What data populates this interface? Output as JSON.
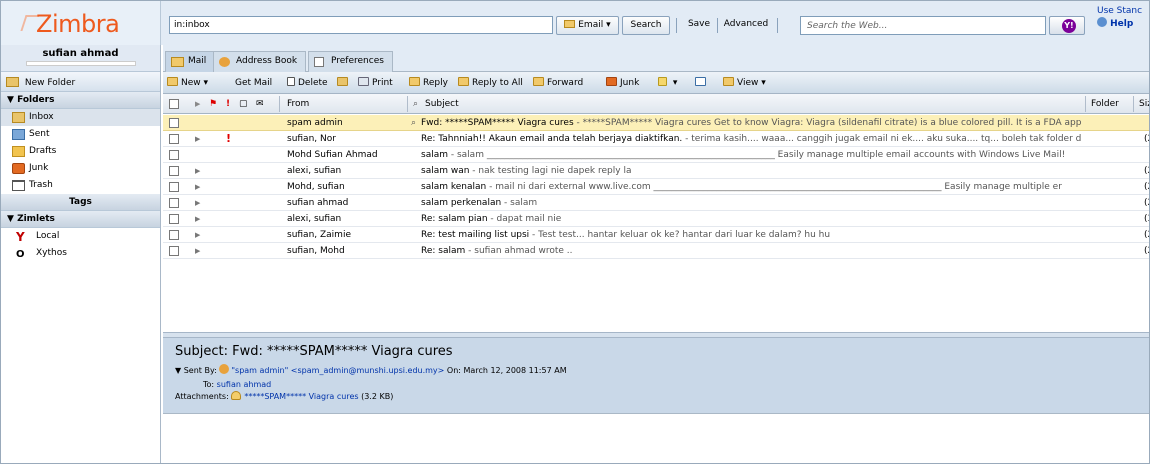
{
  "app": {
    "logo": "Zimbra"
  },
  "header": {
    "search_value": "in:inbox",
    "email_button": "Email",
    "search_button": "Search",
    "save_button": "Save",
    "advanced_button": "Advanced",
    "web_search_placeholder": "Search the Web...",
    "top_right_link1": "Use Stanc",
    "top_right_link2": "Help"
  },
  "user": {
    "name": "sufian ahmad"
  },
  "sidebar": {
    "new_folder": "New Folder",
    "folders_title": "Folders",
    "folders": [
      {
        "label": "Inbox",
        "icon": "inbox-icon"
      },
      {
        "label": "Sent",
        "icon": "sent-icon"
      },
      {
        "label": "Drafts",
        "icon": "drafts-icon"
      },
      {
        "label": "Junk",
        "icon": "junk-icon"
      },
      {
        "label": "Trash",
        "icon": "trash-icon"
      }
    ],
    "tags_title": "Tags",
    "zimlets_title": "Zimlets",
    "zimlets": [
      {
        "label": "Local",
        "icon": "yahoo-local-icon"
      },
      {
        "label": "Xythos",
        "icon": "xythos-icon"
      }
    ]
  },
  "tabs": [
    "Mail",
    "Address Book",
    "Preferences"
  ],
  "toolbar": {
    "new": "New",
    "get_mail": "Get Mail",
    "delete": "Delete",
    "print": "Print",
    "reply": "Reply",
    "reply_all": "Reply to All",
    "forward": "Forward",
    "junk": "Junk",
    "view": "View"
  },
  "list_columns": {
    "from": "From",
    "subject": "Subject",
    "folder": "Folder",
    "size": "Size"
  },
  "messages": [
    {
      "from": "spam admin",
      "subject": "Fwd: *****SPAM***** Viagra cures",
      "fragment": " - *****SPAM***** Viagra cures Get to know Viagra: Viagra (sildenafil citrate) is a blue colored pill. It is a FDA approved",
      "size": "",
      "flag": false,
      "expand": false,
      "attach": true,
      "selected": true
    },
    {
      "from": "sufian, Nor",
      "subject": "Re: Tahnniah!! Akaun email anda telah berjaya diaktifkan.",
      "fragment": " - terima kasih.... waaa... canggih jugak email ni ek.... aku suka.... tq... boleh tak folder dan addre",
      "size": "(2",
      "flag": true,
      "expand": true,
      "attach": false,
      "selected": false
    },
    {
      "from": "Mohd Sufian Ahmad",
      "subject": "salam",
      "fragment": " - salam ________________________________________________________________ Easily manage multiple email accounts with Windows Live Mail!",
      "size": "",
      "flag": false,
      "expand": false,
      "attach": false,
      "selected": false
    },
    {
      "from": "alexi, sufian",
      "subject": "salam wan",
      "fragment": " - nak testing lagi nie dapek reply la",
      "size": "(2",
      "flag": false,
      "expand": true,
      "attach": false,
      "selected": false
    },
    {
      "from": "Mohd, sufian",
      "subject": "salam kenalan",
      "fragment": " - mail ni dari external www.live.com ________________________________________________________________ Easily manage multiple er",
      "size": "(2",
      "flag": false,
      "expand": true,
      "attach": false,
      "selected": false
    },
    {
      "from": "sufian ahmad",
      "subject": "salam perkenalan",
      "fragment": " - salam",
      "size": "(2",
      "flag": false,
      "expand": true,
      "attach": false,
      "selected": false
    },
    {
      "from": "alexi, sufian",
      "subject": "Re: salam pian",
      "fragment": " - dapat mail nie",
      "size": "(3",
      "flag": false,
      "expand": true,
      "attach": false,
      "selected": false
    },
    {
      "from": "sufian, Zaimie",
      "subject": "Re: test mailing list upsi",
      "fragment": " - Test test... hantar keluar ok ke? hantar dari luar ke dalam? hu hu",
      "size": "(2",
      "flag": false,
      "expand": true,
      "attach": false,
      "selected": false
    },
    {
      "from": "sufian, Mohd",
      "subject": "Re: salam",
      "fragment": " - sufian ahmad wrote ..",
      "size": "(2",
      "flag": false,
      "expand": true,
      "attach": false,
      "selected": false
    }
  ],
  "reading": {
    "subject": "Subject: Fwd: *****SPAM***** Viagra cures",
    "sent_by_label": "Sent By:",
    "sender": "\"spam admin\" <spam_admin@munshi.upsi.edu.my>",
    "on_label": "On:",
    "date": "March 12, 2008 11:57 AM",
    "to_label": "To:",
    "to": "sufian ahmad",
    "attachments_label": "Attachments:",
    "attachment_name": "*****SPAM***** Viagra cures",
    "attachment_size": "(3.2 KB)"
  },
  "colors": {
    "accent": "#ee5a1e",
    "selected_row": "#fcf0b8",
    "header_bg": "#e2ebf5"
  }
}
